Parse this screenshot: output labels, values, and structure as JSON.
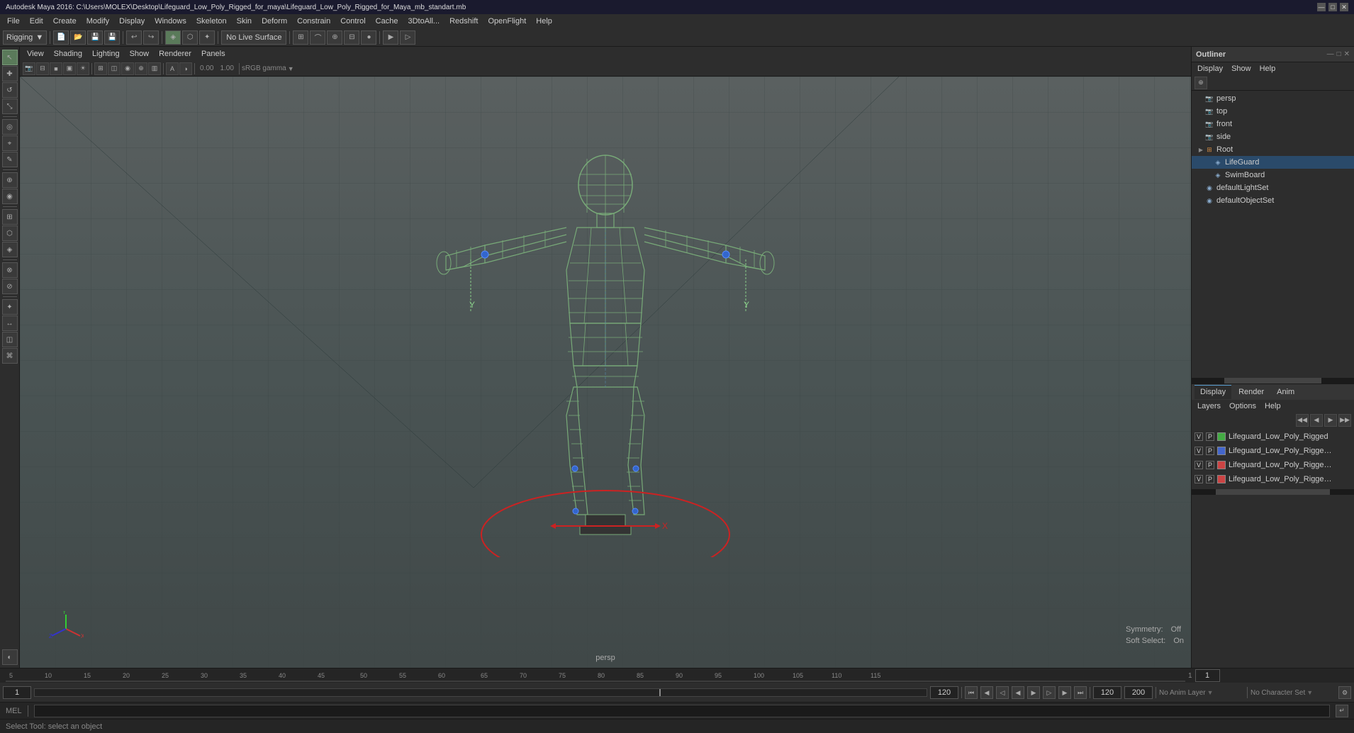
{
  "titlebar": {
    "title": "Autodesk Maya 2016: C:\\Users\\MOLEX\\Desktop\\Lifeguard_Low_Poly_Rigged_for_maya\\Lifeguard_Low_Poly_Rigged_for_Maya_mb_standart.mb",
    "controls": [
      "—",
      "□",
      "✕"
    ]
  },
  "menubar": {
    "items": [
      "File",
      "Edit",
      "Create",
      "Modify",
      "Display",
      "Windows",
      "Skeleton",
      "Skin",
      "Deform",
      "Constrain",
      "Control",
      "Cache",
      "3DtoAll...",
      "Redshift",
      "OpenFlight",
      "Help"
    ]
  },
  "toolbar": {
    "rigging_label": "Rigging",
    "live_surface": "No Live Surface"
  },
  "viewport": {
    "menu_items": [
      "View",
      "Shading",
      "Lighting",
      "Show",
      "Renderer",
      "Panels"
    ],
    "camera": "persp",
    "color_space": "sRGB gamma",
    "value1": "0.00",
    "value2": "1.00"
  },
  "outliner": {
    "title": "Outliner",
    "menu_items": [
      "Display",
      "Show",
      "Help"
    ],
    "tree_items": [
      {
        "id": "persp",
        "label": "persp",
        "type": "camera",
        "depth": 0
      },
      {
        "id": "top",
        "label": "top",
        "type": "camera",
        "depth": 0
      },
      {
        "id": "front",
        "label": "front",
        "type": "camera",
        "depth": 0
      },
      {
        "id": "side",
        "label": "side",
        "type": "camera",
        "depth": 0
      },
      {
        "id": "root",
        "label": "Root",
        "type": "folder",
        "depth": 0
      },
      {
        "id": "lifeguard",
        "label": "LifeGuard",
        "type": "mesh",
        "depth": 1
      },
      {
        "id": "swimboard",
        "label": "SwimBoard",
        "type": "mesh",
        "depth": 1
      },
      {
        "id": "defaultLightSet",
        "label": "defaultLightSet",
        "type": "set",
        "depth": 0
      },
      {
        "id": "defaultObjectSet",
        "label": "defaultObjectSet",
        "type": "set",
        "depth": 0
      }
    ]
  },
  "channel_box": {
    "tabs": [
      "Display",
      "Render",
      "Anim"
    ],
    "active_tab": "Display",
    "menu_items": [
      "Layers",
      "Options",
      "Help"
    ],
    "layers": [
      {
        "label": "Lifeguard_Low_Poly_Rigged",
        "color": "#44aa44",
        "v": "V",
        "p": "P"
      },
      {
        "label": "Lifeguard_Low_Poly_Rigged_Contro",
        "color": "#4466cc",
        "v": "V",
        "p": "P"
      },
      {
        "label": "Lifeguard_Low_Poly_Rigged_bones",
        "color": "#cc4444",
        "v": "V",
        "p": "P"
      },
      {
        "label": "Lifeguard_Low_Poly_Rigged_Helper",
        "color": "#cc4444",
        "v": "V",
        "p": "P"
      }
    ]
  },
  "viewport_info": {
    "symmetry_label": "Symmetry:",
    "symmetry_value": "Off",
    "soft_select_label": "Soft Select:",
    "soft_select_value": "On",
    "camera_label": "persp"
  },
  "timeline": {
    "start_frame": "1",
    "end_frame": "120",
    "playback_start": "1",
    "playback_end": "200",
    "current_frame": "120",
    "anim_layer": "No Anim Layer",
    "char_set": "No Character Set",
    "ruler_marks": [
      "5",
      "10",
      "15",
      "20",
      "25",
      "30",
      "35",
      "40",
      "45",
      "50",
      "55",
      "60",
      "65",
      "70",
      "75",
      "80",
      "85",
      "90",
      "95",
      "100",
      "105",
      "110",
      "115"
    ]
  },
  "mel_bar": {
    "label": "MEL",
    "placeholder": "",
    "status_text": "Select Tool: select an object"
  },
  "playback_controls": {
    "buttons": [
      "⏮",
      "◀◀",
      "◀",
      "▶",
      "▶▶",
      "⏭"
    ]
  }
}
